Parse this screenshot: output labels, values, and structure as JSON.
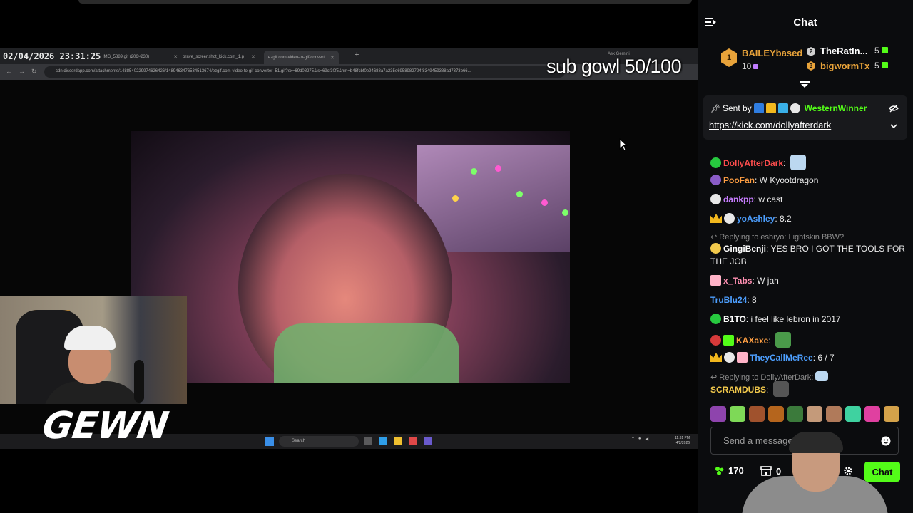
{
  "stream": {
    "timestamp": "02/04/2026 23:31:25",
    "browser_tabs": [
      {
        "label": "IMG_5889.gif (206×230)"
      },
      {
        "label": "brave_screenshot_kick.com_1.p"
      },
      {
        "label": "ezgif.com-video-to-gif-convert"
      }
    ],
    "tab_plus": "+",
    "ask_gemini": "Ask Gemini",
    "url": "cdn.discordapp.com/attachments/1488540229974626426/1489463476534513674/ezgif.com-video-to-gif-converter_51.gif?ex=69d08275&is=69cf30f5&hm=b48fcbf0e94688a7a235e6958982724f8349459388ad7373b66...",
    "sub_goal": "sub gowl 50/100",
    "taskbar": {
      "search_placeholder": "Search",
      "clock_time": "11:31 PM",
      "clock_date": "4/2/2026"
    },
    "logo_text": "GEWN"
  },
  "chat": {
    "title": "Chat",
    "leaderboard": [
      {
        "rank": "1",
        "name": "BAILEYbased",
        "count": "10",
        "color": "#e8a33a"
      },
      {
        "rank": "2",
        "name": "TheRatIn...",
        "count": "5",
        "color": "#ffffff"
      },
      {
        "rank": "3",
        "name": "bigwormTx",
        "count": "5",
        "color": "#e8a33a"
      }
    ],
    "pinned": {
      "sent_by_label": "Sent by",
      "user": "WesternWinner",
      "link": "https://kick.com/dollyafterdark"
    },
    "messages": [
      {
        "user": "DollyAfterDark",
        "text": "",
        "color": "#ff4d4d"
      },
      {
        "user": "PooFan",
        "text": "W Kyootdragon",
        "color": "#ff9f43"
      },
      {
        "user": "dankpp",
        "text": "w cast",
        "color": "#c77dff"
      },
      {
        "user": "yoAshley",
        "text": "8.2",
        "color": "#4d9fff"
      },
      {
        "reply_to": "Replying to eshryo: Lightskin BBW?"
      },
      {
        "user": "GingiBenji",
        "text": "YES BRO I GOT THE TOOLS FOR THE JOB",
        "color": "#ffffff"
      },
      {
        "user": "x_Tabs",
        "text": "W jah",
        "color": "#ff8fb1"
      },
      {
        "user": "TruBlu24",
        "text": "8",
        "color": "#4d9fff"
      },
      {
        "user": "B1TO",
        "text": "i feel like lebron in 2017",
        "color": "#ffffff"
      },
      {
        "user": "KAXaxe",
        "text": "",
        "color": "#ff9f43"
      },
      {
        "user": "TheyCallMeRee",
        "text": "6 / 7",
        "color": "#4d9fff"
      },
      {
        "reply_to": "Replying to DollyAfterDark:"
      },
      {
        "user": "SCRAMDUBS",
        "text": "",
        "color": "#f2c94c"
      }
    ],
    "composer": {
      "placeholder": "Send a message..."
    },
    "footer": {
      "points": "170",
      "store_count": "0",
      "chat_button": "Chat"
    }
  },
  "colors": {
    "accent": "#53fc18",
    "panel_bg": "#0b0c0e",
    "pinned_bg": "#18191c"
  }
}
